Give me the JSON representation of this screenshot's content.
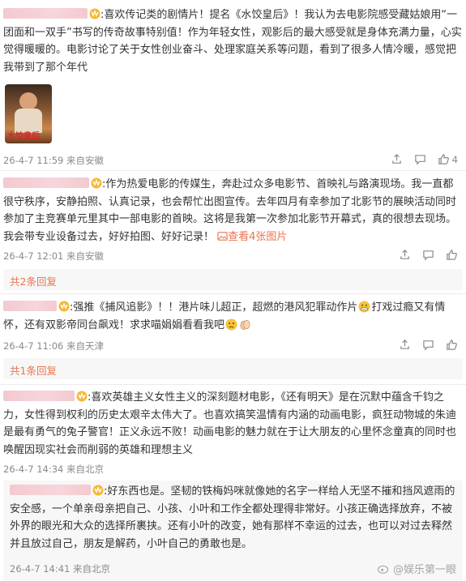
{
  "comments": [
    {
      "text": "喜欢传记类的剧情片！提名《水饺皇后》！我认为去电影院感受藏姑娘用“一团面和一双手”书写的传奇故事特别值！作为年轻女性，观影后的最大感受就是身体充满力量，心实觉得暖暖的。电影讨论了关于女性创业奋斗、处理家庭关系等问题，看到了很多人情冷暖，感觉把我带到了那个年代",
      "date": "26-4-7 11:59",
      "location": "来自安徽",
      "like_count": "4",
      "poster_caption": "水饺皇后"
    },
    {
      "text": "作为热爱电影的传媒生，奔赴过众多电影节、首映礼与路演现场。我一直都很守秩序，安静拍照、认真记录，也会帮忙出图宣传。去年四月有幸参加了北影节的展映活动同时参加了主竞赛单元里其中一部电影的首映。这将是我第一次参加北影节开幕式，真的很想去现场。我会带专业设备过去，好好拍图、好好记录！",
      "view_pics": "查看4张图片",
      "date": "26-4-7 12:01",
      "location": "来自安徽",
      "replies_link": "共2条回复"
    },
    {
      "text": "强推《捕风追影》！！港片味儿超正，超燃的港风犯罪动作片",
      "text2": "打戏过瘾又有情怀，还有双影帝同台飙戏！求求喵娟娟看看我吧",
      "date": "26-4-7 11:06",
      "location": "来自天津",
      "replies_link": "共1条回复"
    },
    {
      "text": "喜欢英雄主义女性主义的深刻题材电影，《还有明天》是在沉默中蕴含千钧之力，女性得到权利的历史太艰辛太伟大了。也喜欢搞笑温情有内涵的动画电影，疯狂动物城的朱迪是最有勇气的兔子警官！正义永远不败！动画电影的魅力就在于让大朋友的心里怀念童真的同时也唤醒因现实社会而削弱的英雄和理想主义",
      "date": "26-4-7 14:34",
      "location": "来自北京"
    },
    {
      "text": "好东西也是。坚韧的铁梅妈咪就像她的名字一样给人无坚不摧和挡风遮雨的安全感，一个单亲母亲把自己、小孩、小叶和工作全都处理得非常好。小孩正确选择放弃，不被外界的眼光和大众的选择所裹挟。还有小叶的改变，她有那样不幸运的过去，也可以对过去释然并且放过自己，朋友是解药，小叶自己的勇敢也是。",
      "date": "26-4-7 14:41",
      "location": "来自北京"
    }
  ],
  "watermark": "@娱乐第一眼",
  "colors": {
    "accent": "#eb7350",
    "meta": "#8a8a8a",
    "text": "#333333"
  },
  "icons": [
    "vip-badge-icon",
    "share-icon",
    "comment-icon",
    "like-icon",
    "picture-icon",
    "grimace-emoji-icon",
    "sad-emoji-icon",
    "clap-emoji-icon",
    "weibo-logo-icon"
  ]
}
